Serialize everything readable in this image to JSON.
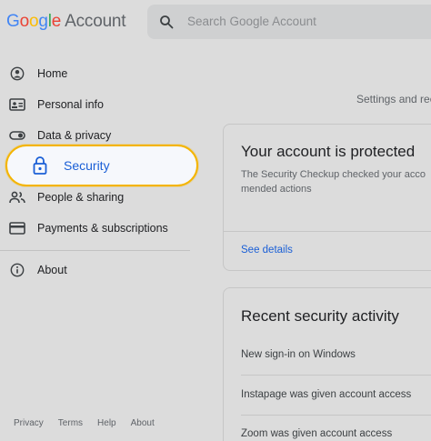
{
  "header": {
    "logo_letters": [
      "G",
      "o",
      "o",
      "g",
      "l",
      "e"
    ],
    "logo_product": "Account",
    "search_placeholder": "Search Google Account"
  },
  "sidebar": {
    "items": [
      {
        "label": "Home",
        "icon": "person-circle-icon"
      },
      {
        "label": "Personal info",
        "icon": "id-card-icon"
      },
      {
        "label": "Data & privacy",
        "icon": "toggle-icon"
      },
      {
        "label": "Security",
        "icon": "lock-icon",
        "active": true
      },
      {
        "label": "People & sharing",
        "icon": "people-icon"
      },
      {
        "label": "Payments & subscriptions",
        "icon": "credit-card-icon"
      },
      {
        "label": "About",
        "icon": "info-icon"
      }
    ],
    "footer_links": [
      "Privacy",
      "Terms",
      "Help",
      "About"
    ]
  },
  "main": {
    "settings_text": "Settings and rec",
    "protected_card": {
      "title": "Your account is protected",
      "description": "The Security Checkup checked your acco mended actions",
      "link": "See details"
    },
    "activity_card": {
      "title": "Recent security activity",
      "rows": [
        "New sign-in on Windows",
        "Instapage was given account access",
        "Zoom was given account access"
      ]
    }
  },
  "colors": {
    "accent_blue": "#1a5fd6",
    "highlight_border": "#f4b400",
    "background": "#dcdcdc"
  }
}
